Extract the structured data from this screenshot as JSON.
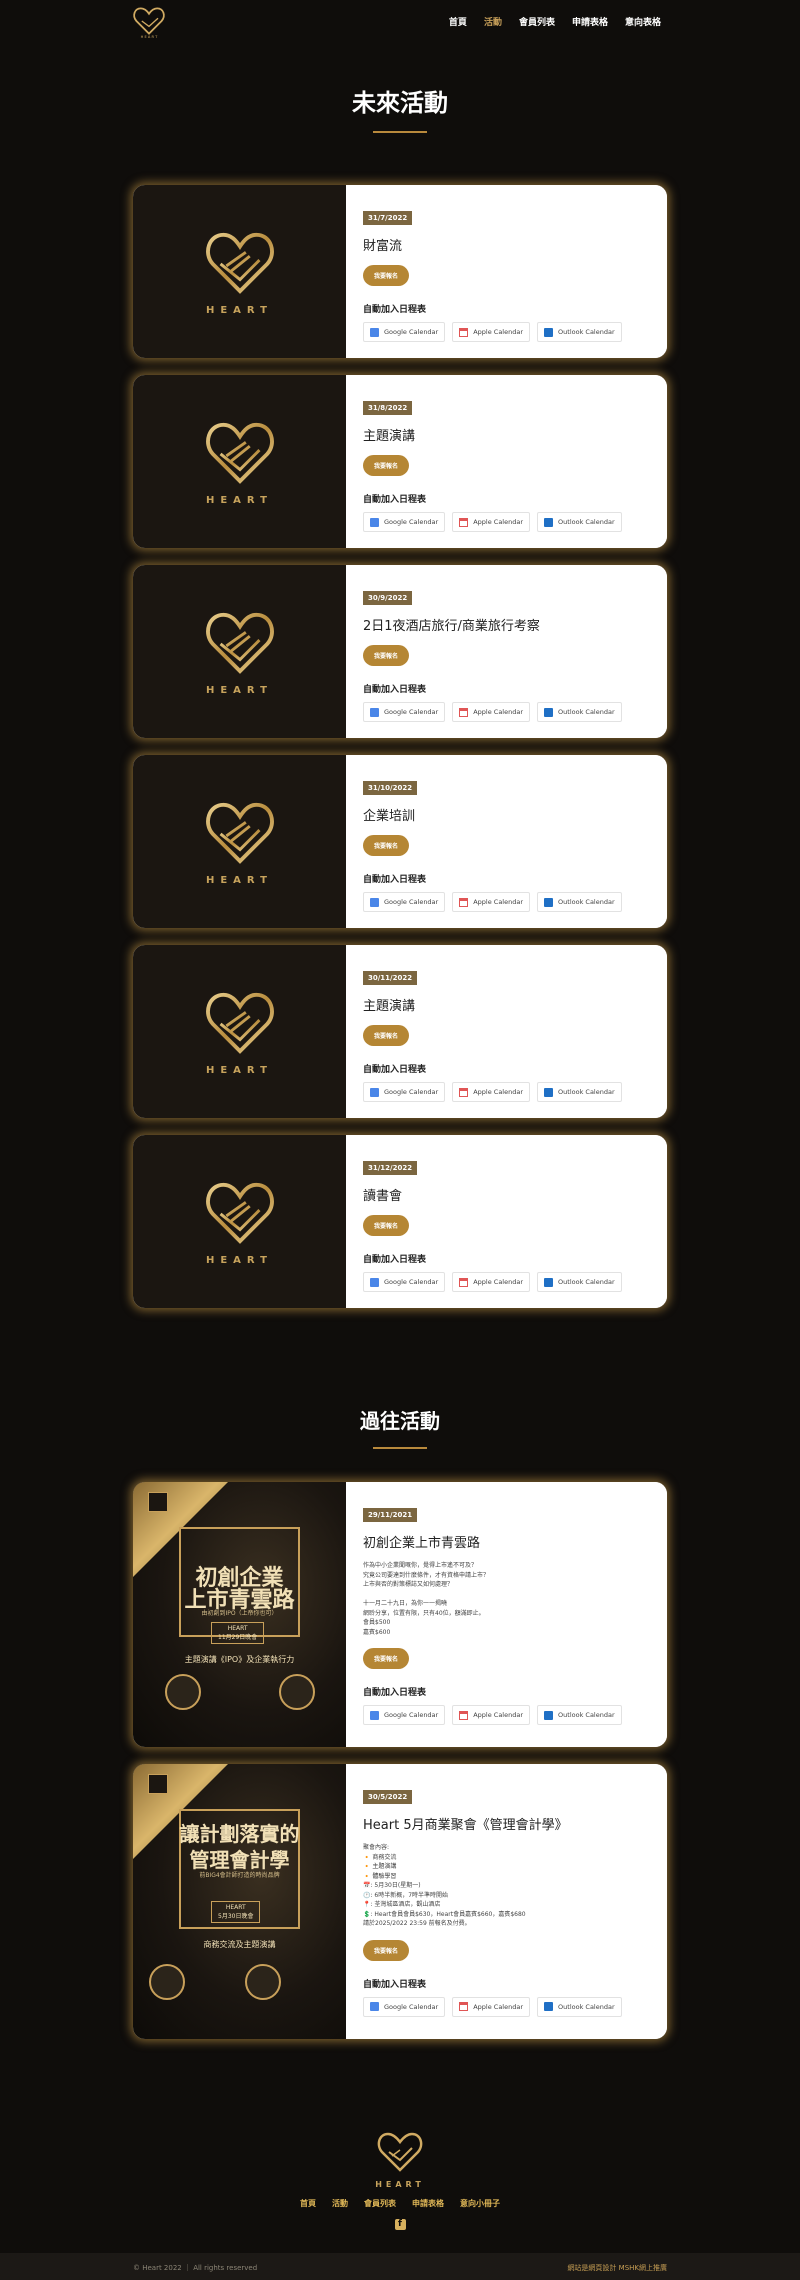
{
  "header": {
    "nav": [
      {
        "label": "首頁",
        "active": false
      },
      {
        "label": "活動",
        "active": true
      },
      {
        "label": "會員列表",
        "active": false
      },
      {
        "label": "申請表格",
        "active": false
      },
      {
        "label": "意向表格",
        "active": false
      }
    ]
  },
  "future": {
    "title": "未來活動",
    "events": [
      {
        "date": "31/7/2022",
        "title": "財富流"
      },
      {
        "date": "31/8/2022",
        "title": "主題演講"
      },
      {
        "date": "30/9/2022",
        "title": "2日1夜酒店旅行/商業旅行考察"
      },
      {
        "date": "31/10/2022",
        "title": "企業培訓"
      },
      {
        "date": "30/11/2022",
        "title": "主題演講"
      },
      {
        "date": "31/12/2022",
        "title": "讀書會"
      }
    ]
  },
  "past": {
    "title": "過往活動",
    "events": [
      {
        "date": "29/11/2021",
        "title": "初創企業上市青雲路",
        "desc": "作為中小企業聞嘅你，覺得上市遙不可及？\n究竟公司要達到什麼條件，才有資格申請上市？\n上市與否的對策標誌又如何處理？\n\n十一月二十九日，為你一一揭曉\n網聆分享，位置有限，只有40位，額滿即止。\n會員$500\n嘉賓$600",
        "poster": {
          "line1": "初創企業",
          "line2": "上市青雲路",
          "sub": "由初創到IPO（上帝你也可）",
          "box1": "HEART",
          "box2": "11月29日晚會",
          "topic": "主題演講《IPO》及企業執行力"
        }
      },
      {
        "date": "30/5/2022",
        "title": "Heart 5月商業聚會《管理會計學》",
        "desc": "聚會內容:\n🔸 商務交流\n🔸 主題演講\n🔸 體驗學習\n📅: 5月30日(星期一)\n🕐: 6時半新概，7時半準時開始\n📍: 荃灣城區酒店，觀山酒店\n💲: Heart會員會員$630，Heart會員嘉賓$660，嘉賓$680\n請於2025/2022 23:59 前報名及付費。",
        "poster": {
          "line1": "讓計劃落實的",
          "line2": "管理會計學",
          "sub": "前BIG4會計師打造的時尚品牌",
          "box1": "HEART",
          "box2": "5月30日晚會",
          "topic": "商務交流及主題演講"
        }
      }
    ]
  },
  "labels": {
    "signup": "我要報名",
    "calendar_heading": "自動加入日程表",
    "google": "Google Calendar",
    "apple": "Apple Calendar",
    "outlook": "Outlook Calendar",
    "heart_word": "HEART"
  },
  "footer": {
    "heart_word": "HEART",
    "nav": [
      "首頁",
      "活動",
      "會員列表",
      "申請表格",
      "意向小冊子"
    ],
    "facebook_icon": "f",
    "copyright": "© Heart 2022 ｜ All rights reserved",
    "credits": "網站是網頁設計    MSHK網上推廣"
  },
  "colors": {
    "accent": "#b58634",
    "gold": "#c8a05a",
    "date_badge": "#7b6640",
    "background": "#0f0d0b"
  }
}
